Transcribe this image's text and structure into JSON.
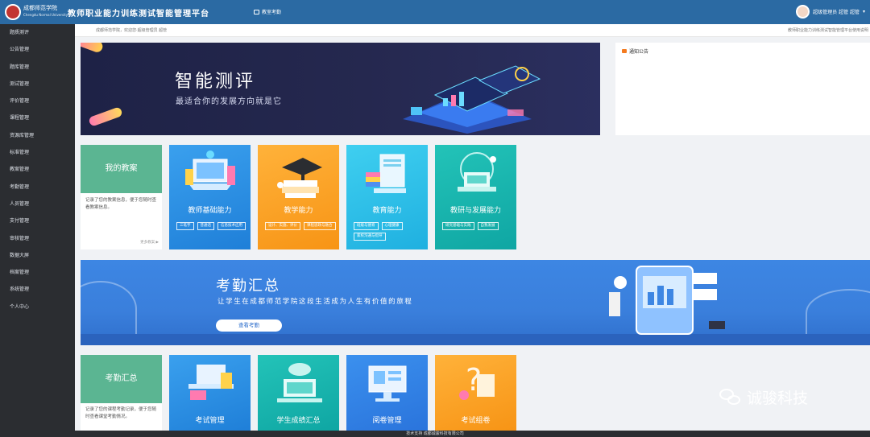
{
  "header": {
    "school_name": "成都师范学院",
    "school_sub": "Chengdu Normal University",
    "app_title": "教师职业能力训练测试智能管理平台",
    "nav_link": "教室考勤",
    "user_text": "超级管理员 超管 超管"
  },
  "sidebar": {
    "items": [
      {
        "label": "题质测评"
      },
      {
        "label": "公告管理"
      },
      {
        "label": "题库管理"
      },
      {
        "label": "测试管理"
      },
      {
        "label": "评价管理"
      },
      {
        "label": "课程管理"
      },
      {
        "label": "资源库管理"
      },
      {
        "label": "标准管理"
      },
      {
        "label": "教案管理"
      },
      {
        "label": "考勤管理"
      },
      {
        "label": "人员管理"
      },
      {
        "label": "支付管理"
      },
      {
        "label": "审核管理"
      },
      {
        "label": "数据大屏"
      },
      {
        "label": "档案管理"
      },
      {
        "label": "系统管理"
      },
      {
        "label": "个人中心"
      }
    ]
  },
  "breadcrumb": {
    "left": "成都师范学院，欢迎您·超级管理员 超管",
    "right": "教师职业能力训练测试智能管理平台使用说明"
  },
  "banner_top": {
    "title": "智能测评",
    "subtitle": "最适合你的发展方向就是它"
  },
  "notice": {
    "title": "通知公告"
  },
  "plan_card": {
    "title": "我的教案",
    "desc": "记录了您的教案信息，便于您随时查看教案信息。",
    "more": "更多教案 ▶"
  },
  "ability_cards": [
    {
      "label": "教师基础能力",
      "color": "#2e8fe0",
      "tags": [
        "三笔字",
        "普通话",
        "信息技术应用"
      ]
    },
    {
      "label": "教学能力",
      "color": "#f7a123",
      "tags": [
        "设计、实施、评价",
        "课程思政与融合"
      ]
    },
    {
      "label": "教育能力",
      "color": "#2ab9e4",
      "tags": [
        "班级与德育",
        "心理健康",
        "家校沟通与指导"
      ]
    },
    {
      "label": "教研与发展能力",
      "color": "#14b2ad",
      "tags": [
        "研究基础与实践",
        "自我发展"
      ]
    }
  ],
  "banner_attendance": {
    "title": "考勤汇总",
    "subtitle": "让学生在成都师范学院这段生活成为人生有价值的旅程",
    "button": "查看考勤"
  },
  "att_card": {
    "title": "考勤汇总",
    "desc": "记录了您的课程考勤记录，便于您随时查看课堂考勤情况。"
  },
  "bottom_cards": [
    {
      "label": "考试管理",
      "color": "#2f8be0"
    },
    {
      "label": "学生成绩汇总",
      "color": "#16b5b0"
    },
    {
      "label": "阅卷管理",
      "color": "#2f7fe0"
    },
    {
      "label": "考试组卷",
      "color": "#f7a123"
    }
  ],
  "footer": {
    "text": "技术支持 成都诚骏科技有限公司"
  },
  "watermark": {
    "text": "诚骏科技"
  },
  "colors": {
    "header": "#2b6aa3",
    "sidebar": "#2b2d31",
    "green_head": "#5bb592"
  }
}
